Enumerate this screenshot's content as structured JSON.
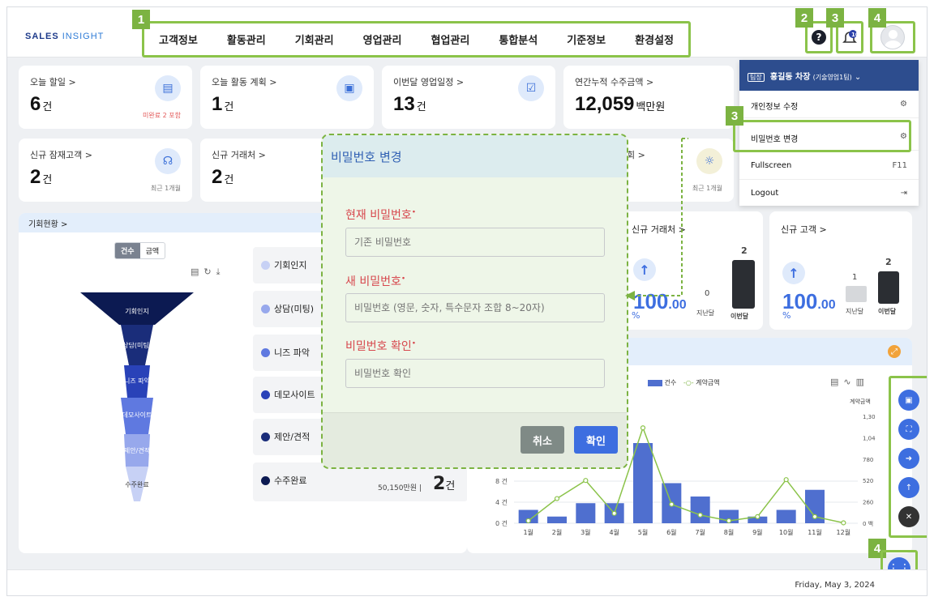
{
  "header": {
    "logo_main": "SALES",
    "logo_sub": "INSIGHT",
    "nav": [
      "고객정보",
      "활동관리",
      "기회관리",
      "영업관리",
      "협업관리",
      "통합분석",
      "기준정보",
      "환경설정"
    ],
    "notification_count": "10",
    "help_glyph": "?"
  },
  "callouts": {
    "nav": "1",
    "help": "2",
    "bell": "3",
    "profile": "4",
    "password": "3",
    "fab": "4"
  },
  "kpi_cards": [
    {
      "title": "오늘 할일 >",
      "value": "6",
      "unit": "건",
      "note": "미완료 2 포함"
    },
    {
      "title": "오늘 활동 계획 >",
      "value": "1",
      "unit": "건",
      "note": ""
    },
    {
      "title": "이번달 영업일정 >",
      "value": "13",
      "unit": "건",
      "note": ""
    },
    {
      "title": "연간누적 수주금액 >",
      "value": "12,059",
      "unit": "백만원",
      "note": ""
    },
    {
      "title": "신규 잠재고객 >",
      "value": "2",
      "unit": "건",
      "note": "최근 1개월"
    },
    {
      "title": "신규 거래처 >",
      "value": "2",
      "unit": "건",
      "note": ""
    },
    {
      "title": "",
      "value": "",
      "unit": "",
      "note": "최근 1개월"
    }
  ],
  "opportunity": {
    "title": "기회현황 >",
    "toggle": [
      "건수",
      "금액"
    ],
    "stages": [
      "기회인지",
      "상담(미팅)",
      "니즈 파악",
      "데모사이트",
      "제안/견적",
      "수주완료"
    ],
    "stage_colors": [
      "#c7d1f5",
      "#97a8ec",
      "#5f79e0",
      "#2942b8",
      "#1a2d7a",
      "#0c1a52"
    ],
    "final_amount": "50,150만원",
    "final_sep": "|",
    "final_count": "2",
    "final_unit": "건"
  },
  "new_clients": {
    "title": "신규 거래처 >",
    "pct": "100",
    "pct_dec": ".00",
    "pct_sign": "%",
    "prev_value": "0",
    "curr_value": "2",
    "prev_label": "지난달",
    "curr_label": "이번달"
  },
  "new_customers": {
    "title": "신규 고객 >",
    "pct": "100",
    "pct_dec": ".00",
    "pct_sign": "%",
    "prev_value": "1",
    "curr_value": "2",
    "prev_label": "지난달",
    "curr_label": "이번달"
  },
  "monthly_chart": {
    "legend_bar": "건수",
    "legend_line": "계약금액",
    "right_axis_title": "계약금액",
    "left_ticks": [
      "8 건",
      "4 건",
      "0 건"
    ],
    "right_ticks": [
      "1,30",
      "1,04",
      "780",
      "520",
      "260",
      "0 백"
    ]
  },
  "chart_data": {
    "type": "bar",
    "categories": [
      "1월",
      "2월",
      "3월",
      "4월",
      "5월",
      "6월",
      "7월",
      "8월",
      "9월",
      "10월",
      "11월",
      "12월"
    ],
    "series": [
      {
        "name": "건수",
        "type": "bar",
        "axis": "left",
        "values": [
          2,
          1,
          3,
          3,
          12,
          6,
          4,
          2,
          1,
          2,
          5,
          0
        ]
      },
      {
        "name": "계약금액",
        "type": "line",
        "axis": "right",
        "values": [
          30,
          300,
          520,
          120,
          1160,
          230,
          100,
          30,
          80,
          530,
          80,
          5
        ]
      }
    ],
    "ylim_left": [
      0,
      16
    ],
    "ylim_right": [
      0,
      1300
    ]
  },
  "modal": {
    "title": "비밀번호 변경",
    "current_label": "현재 비밀번호",
    "current_placeholder": "기존 비밀번호",
    "new_label": "새 비밀번호",
    "new_placeholder": "비밀번호 (영문, 숫자, 특수문자 조합 8~20자)",
    "confirm_label": "비밀번호 확인",
    "confirm_placeholder": "비밀번호 확인",
    "required_mark": "•",
    "cancel": "취소",
    "ok": "확인"
  },
  "profile_menu": {
    "role_tag": "팀장",
    "user": "홍길동 차장",
    "team": "(기술영업1팀)",
    "items": [
      {
        "label": "개인정보 수정",
        "right": ""
      },
      {
        "label": "비밀번호 변경",
        "right": ""
      },
      {
        "label": "Fullscreen",
        "right": "F11"
      },
      {
        "label": "Logout",
        "right": ""
      }
    ]
  },
  "footer": {
    "date": "Friday, May 3, 2024"
  },
  "colors": {
    "accent": "#3d6ee0",
    "callout": "#7cb342",
    "header_nav": "#2d4d8e"
  }
}
